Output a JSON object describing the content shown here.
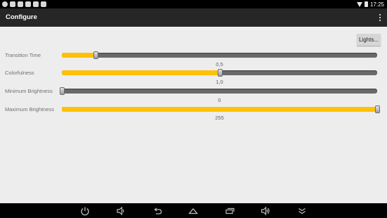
{
  "status_bar": {
    "time": "17:25",
    "icons": [
      "android-icon",
      "photo-icon",
      "download-icon",
      "usb-icon",
      "keyboard-icon",
      "mail-icon",
      "wifi-icon",
      "battery-icon"
    ]
  },
  "action_bar": {
    "title": "Configure",
    "overflow_icon": "more-vert-icon"
  },
  "lights_button": {
    "label": "Lights..."
  },
  "settings": [
    {
      "label": "Transition Time",
      "value_text": "0,5",
      "level": 0.107
    },
    {
      "label": "Colorfulness",
      "value_text": "1,0",
      "level": 0.5
    },
    {
      "label": "Minimum Brightness",
      "value_text": "0",
      "level": 0.0
    },
    {
      "label": "Maximum Brightness",
      "value_text": "255",
      "level": 1.0
    }
  ],
  "nav_bar": {
    "icons": [
      "power-icon",
      "volume-down-icon",
      "back-icon",
      "home-icon",
      "recents-icon",
      "volume-up-icon",
      "collapse-icon"
    ]
  },
  "colors": {
    "accent": "#ffc107",
    "track": "#6a6a6a",
    "background": "#ededed",
    "action_bar": "#262626"
  }
}
